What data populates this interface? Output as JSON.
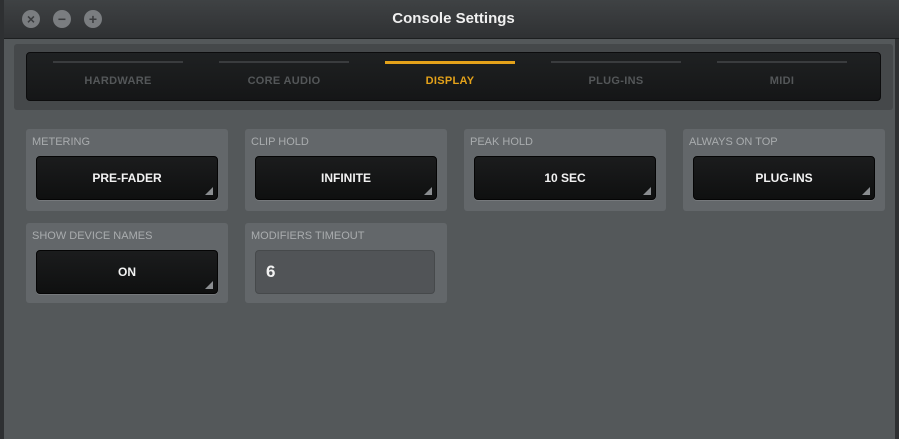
{
  "window": {
    "title": "Console Settings"
  },
  "tabs": [
    {
      "label": "HARDWARE",
      "active": false
    },
    {
      "label": "CORE AUDIO",
      "active": false
    },
    {
      "label": "DISPLAY",
      "active": true
    },
    {
      "label": "PLUG-INS",
      "active": false
    },
    {
      "label": "MIDI",
      "active": false
    }
  ],
  "settings": {
    "metering": {
      "label": "METERING",
      "value": "PRE-FADER"
    },
    "clip_hold": {
      "label": "CLIP HOLD",
      "value": "INFINITE"
    },
    "peak_hold": {
      "label": "PEAK HOLD",
      "value": "10 SEC"
    },
    "always_on_top": {
      "label": "ALWAYS ON TOP",
      "value": "PLUG-INS"
    },
    "show_device_names": {
      "label": "SHOW DEVICE NAMES",
      "value": "ON"
    },
    "modifiers_timeout": {
      "label": "MODIFIERS TIMEOUT",
      "value": "6"
    }
  },
  "colors": {
    "accent": "#e4a21a",
    "background": "#54585a",
    "panel": "#63676a"
  },
  "icons": {
    "close": "close-icon",
    "minimize": "minimize-icon",
    "zoom": "zoom-icon"
  }
}
